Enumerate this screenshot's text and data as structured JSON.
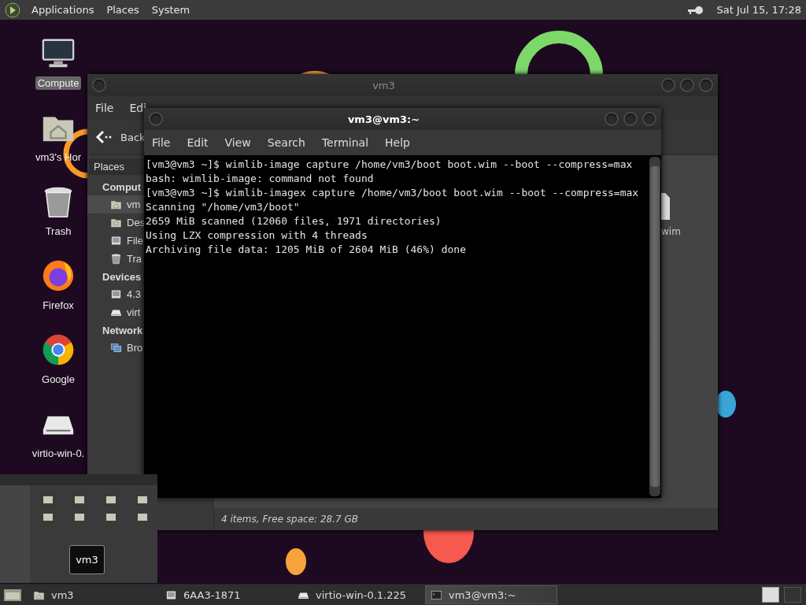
{
  "top_panel": {
    "menus": [
      "Applications",
      "Places",
      "System"
    ],
    "clock": "Sat Jul 15, 17:28"
  },
  "desktop_icons": [
    {
      "label": "Compute",
      "kind": "computer",
      "selected": true
    },
    {
      "label": "vm3's Hor",
      "kind": "home",
      "selected": false
    },
    {
      "label": "Trash",
      "kind": "trash",
      "selected": false
    },
    {
      "label": "Firefox",
      "kind": "firefox",
      "selected": false
    },
    {
      "label": "Google",
      "kind": "chrome",
      "selected": false
    },
    {
      "label": "virtio-win-0.",
      "kind": "drive",
      "selected": false
    }
  ],
  "file_manager": {
    "title": "vm3",
    "menus": [
      "File",
      "Edi"
    ],
    "back": "Back",
    "places_label": "Places",
    "sidebar": [
      {
        "heading": "Comput",
        "items": [
          {
            "label": "vm",
            "kind": "home",
            "selected": true
          },
          {
            "label": "Des",
            "kind": "desktop",
            "selected": false
          },
          {
            "label": "File",
            "kind": "disk",
            "selected": false
          },
          {
            "label": "Tra",
            "kind": "trash",
            "selected": false
          }
        ]
      },
      {
        "heading": "Devices",
        "items": [
          {
            "label": "4.3",
            "kind": "disk",
            "selected": false
          },
          {
            "label": "virt",
            "kind": "drive",
            "selected": false
          }
        ]
      },
      {
        "heading": "Network",
        "items": [
          {
            "label": "Bro",
            "kind": "network",
            "selected": false
          }
        ]
      }
    ],
    "file_label": "wim",
    "status": "4 items, Free space: 28.7 GB"
  },
  "terminal": {
    "title": "vm3@vm3:~",
    "menus": [
      "File",
      "Edit",
      "View",
      "Search",
      "Terminal",
      "Help"
    ],
    "lines": [
      "[vm3@vm3 ~]$ wimlib-image capture /home/vm3/boot boot.wim --boot --compress=max",
      "bash: wimlib-image: command not found",
      "[vm3@vm3 ~]$ wimlib-imagex capture /home/vm3/boot boot.wim --boot --compress=max",
      "Scanning \"/home/vm3/boot\"",
      "2659 MiB scanned (12060 files, 1971 directories)",
      "Using LZX compression with 4 threads",
      "Archiving file data: 1205 MiB of 2604 MiB (46%) done"
    ]
  },
  "preview": {
    "label": "vm3"
  },
  "taskbar": {
    "tasks": [
      {
        "label": "vm3",
        "kind": "home",
        "selected": false
      },
      {
        "label": "6AA3-1871",
        "kind": "disk",
        "selected": false
      },
      {
        "label": "virtio-win-0.1.225",
        "kind": "drive",
        "selected": false
      },
      {
        "label": "vm3@vm3:~",
        "kind": "terminal",
        "selected": true
      }
    ],
    "workspaces": [
      {
        "selected": true
      },
      {
        "selected": false
      }
    ]
  }
}
